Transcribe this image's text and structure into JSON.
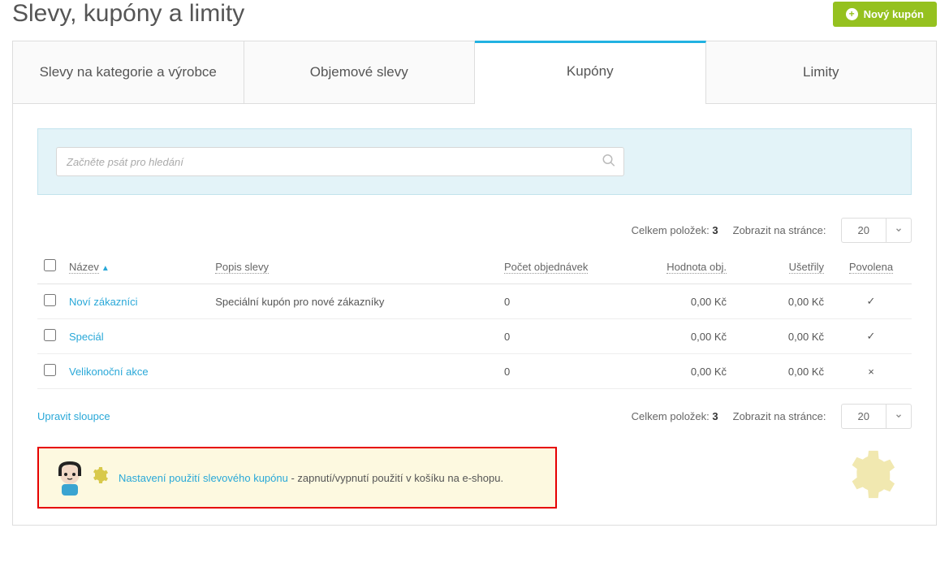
{
  "header": {
    "title": "Slevy, kupóny a limity",
    "new_button": "Nový kupón"
  },
  "tabs": [
    "Slevy na kategorie a výrobce",
    "Objemové slevy",
    "Kupóny",
    "Limity"
  ],
  "active_tab_index": 2,
  "search": {
    "placeholder": "Začněte psát pro hledání"
  },
  "pager": {
    "total_label": "Celkem položek:",
    "total_value": "3",
    "page_size_label": "Zobrazit na stránce:",
    "page_size_value": "20"
  },
  "columns": {
    "name": "Název",
    "desc": "Popis slevy",
    "orders": "Počet objednávek",
    "obj_value": "Hodnota obj.",
    "saved": "Ušetřily",
    "enabled": "Povolena"
  },
  "rows": [
    {
      "name": "Noví zákazníci",
      "desc": "Speciální kupón pro nové zákazníky",
      "orders": "0",
      "obj_value": "0,00 Kč",
      "saved": "0,00 Kč",
      "enabled": "✓"
    },
    {
      "name": "Speciál",
      "desc": "",
      "orders": "0",
      "obj_value": "0,00 Kč",
      "saved": "0,00 Kč",
      "enabled": "✓"
    },
    {
      "name": "Velikonoční akce",
      "desc": "",
      "orders": "0",
      "obj_value": "0,00 Kč",
      "saved": "0,00 Kč",
      "enabled": "×"
    }
  ],
  "edit_columns": "Upravit sloupce",
  "hint": {
    "link": "Nastavení použití slevového kupónu",
    "rest": " - zapnutí/vypnutí použití v košíku na e-shopu."
  }
}
